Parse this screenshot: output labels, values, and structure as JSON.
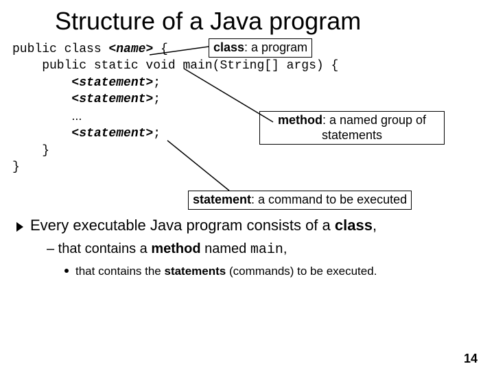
{
  "title": "Structure of a Java program",
  "code": {
    "l1a": "public class ",
    "l1b": "<name>",
    "l1c": " {",
    "l2": "    public static void main(String[] args) {",
    "stmt": "<statement>",
    "semi": ";",
    "dots": "...",
    "l7": "    }",
    "l8": "}"
  },
  "callouts": {
    "class_b": "class",
    "class_rest": ": a program",
    "method_b": "method",
    "method_rest": ": a named group of statements",
    "statement_b": "statement",
    "statement_rest": ": a command to be executed"
  },
  "bullets": {
    "b1a": "Every executable Java program consists of a ",
    "b1b": "class",
    "b1c": ",",
    "b2a": "– that contains a ",
    "b2b": "method",
    "b2c": " named ",
    "b2d": "main",
    "b2e": ",",
    "b3a": "that contains the ",
    "b3b": "statements",
    "b3c": " (commands) to be executed."
  },
  "page": "14"
}
